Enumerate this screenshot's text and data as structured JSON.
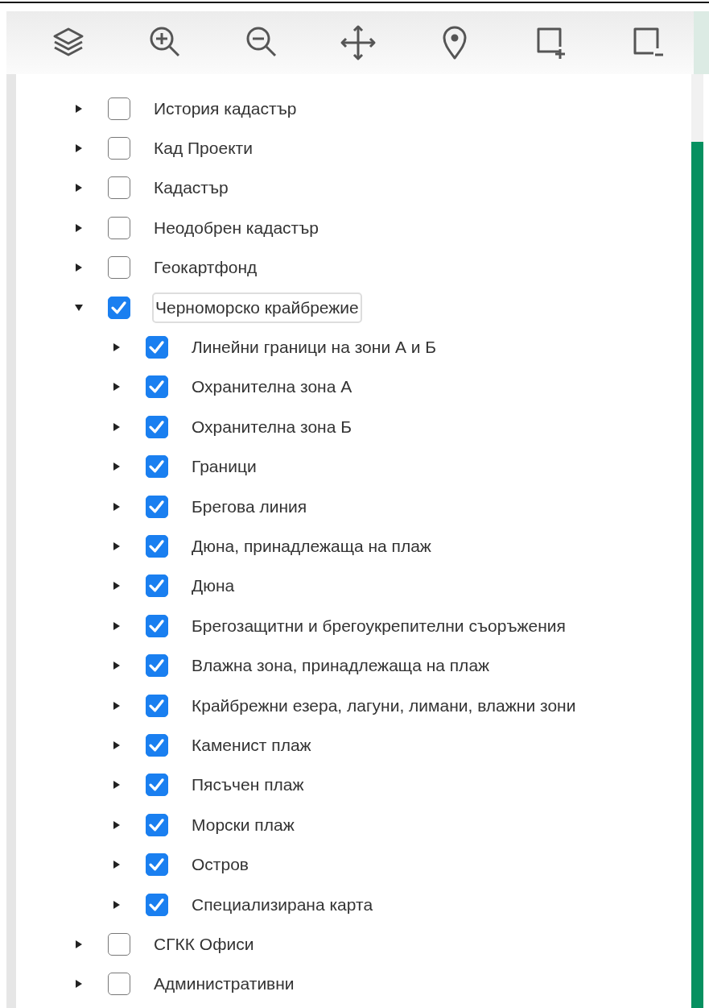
{
  "toolbar": {
    "tools": [
      {
        "kind": "layers"
      },
      {
        "kind": "zoom-in"
      },
      {
        "kind": "zoom-out"
      },
      {
        "kind": "pan"
      },
      {
        "kind": "marker"
      },
      {
        "kind": "select-add"
      },
      {
        "kind": "select-remove"
      }
    ]
  },
  "layer_tree": [
    {
      "label": "История кадастър",
      "checked": false,
      "expanded": false,
      "selected": false
    },
    {
      "label": "Кад Проекти",
      "checked": false,
      "expanded": false,
      "selected": false
    },
    {
      "label": "Кадастър",
      "checked": false,
      "expanded": false,
      "selected": false
    },
    {
      "label": "Неодобрен кадастър",
      "checked": false,
      "expanded": false,
      "selected": false
    },
    {
      "label": "Геокартфонд",
      "checked": false,
      "expanded": false,
      "selected": false
    },
    {
      "label": "Черноморско крайбрежие",
      "checked": true,
      "expanded": true,
      "selected": true,
      "children": [
        {
          "label": "Линейни граници на зони А и Б",
          "checked": true,
          "expanded": false,
          "selected": false
        },
        {
          "label": "Охранителна зона А",
          "checked": true,
          "expanded": false,
          "selected": false
        },
        {
          "label": "Охранителна зона Б",
          "checked": true,
          "expanded": false,
          "selected": false
        },
        {
          "label": "Граници",
          "checked": true,
          "expanded": false,
          "selected": false
        },
        {
          "label": "Брегова линия",
          "checked": true,
          "expanded": false,
          "selected": false
        },
        {
          "label": "Дюна, принадлежаща на плаж",
          "checked": true,
          "expanded": false,
          "selected": false
        },
        {
          "label": "Дюна",
          "checked": true,
          "expanded": false,
          "selected": false
        },
        {
          "label": "Брегозащитни и брегоукрепителни съоръжения",
          "checked": true,
          "expanded": false,
          "selected": false
        },
        {
          "label": "Влажна зона, принадлежаща на плаж",
          "checked": true,
          "expanded": false,
          "selected": false
        },
        {
          "label": "Крайбрежни езера, лагуни, лимани, влажни зони",
          "checked": true,
          "expanded": false,
          "selected": false
        },
        {
          "label": "Каменист плаж",
          "checked": true,
          "expanded": false,
          "selected": false
        },
        {
          "label": "Пясъчен плаж",
          "checked": true,
          "expanded": false,
          "selected": false
        },
        {
          "label": "Морски плаж",
          "checked": true,
          "expanded": false,
          "selected": false
        },
        {
          "label": "Остров",
          "checked": true,
          "expanded": false,
          "selected": false
        },
        {
          "label": "Специализирана карта",
          "checked": true,
          "expanded": false,
          "selected": false
        }
      ]
    },
    {
      "label": "СГКК Офиси",
      "checked": false,
      "expanded": false,
      "selected": false
    },
    {
      "label": "Административни",
      "checked": false,
      "expanded": false,
      "selected": false
    }
  ]
}
